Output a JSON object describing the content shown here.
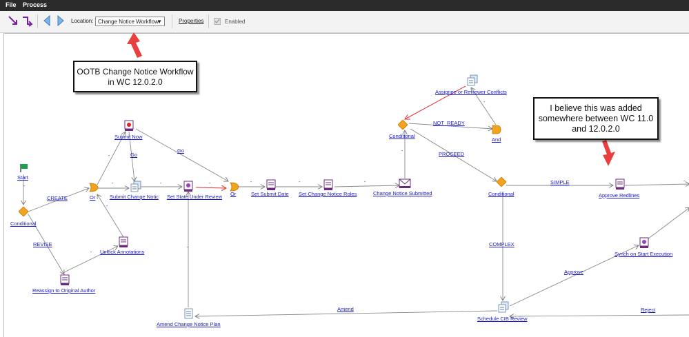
{
  "menu": {
    "file": "File",
    "process": "Process"
  },
  "toolbar": {
    "location_label": "Location:",
    "location_value": "Change Notice Workflow",
    "properties_label": "Properties",
    "enabled_label": "Enabled"
  },
  "callouts": {
    "ootb": "OOTB Change Notice Workflow in WC 12.0.2.0",
    "added": "I believe this was added somewhere between WC 11.0 and 12.0.2.0"
  },
  "nodes": {
    "start": "Start",
    "conditional_left": "Conditional",
    "reassign": "Reassign to Original Author",
    "unlock": "Unlock Annotations",
    "or_left": "Or",
    "submit_now": "Submit Now",
    "submit_change_notice": "Submit Change Notic",
    "set_state": "Set State Under Review",
    "or_mid": "Or",
    "set_submit_date": "Set Submit Date",
    "set_roles": "Set Change Notice Roles",
    "cn_submitted": "Change Notice Submitted",
    "conditional_top": "Conditional",
    "assignee_conflicts": "Assignee or Reviewer Conflicts",
    "and": "And",
    "conditional_mid": "Conditional",
    "approve_redlines": "Approve Redlines",
    "synch": "Synch on Start Execution",
    "schedule_cib": "Schedule CIB Review",
    "amend_plan": "Amend Change Notice Plan"
  },
  "routes": {
    "create": "CREATE",
    "revise": "REVISE",
    "go_1": "Go",
    "go_2": "Go",
    "not_ready": "NOT_READY",
    "proceed": "PROCEED",
    "simple": "SIMPLE",
    "complex": "COMPLEX",
    "approve": "Approve",
    "amend": "Amend",
    "reject": "Reject",
    "dash": "-"
  }
}
